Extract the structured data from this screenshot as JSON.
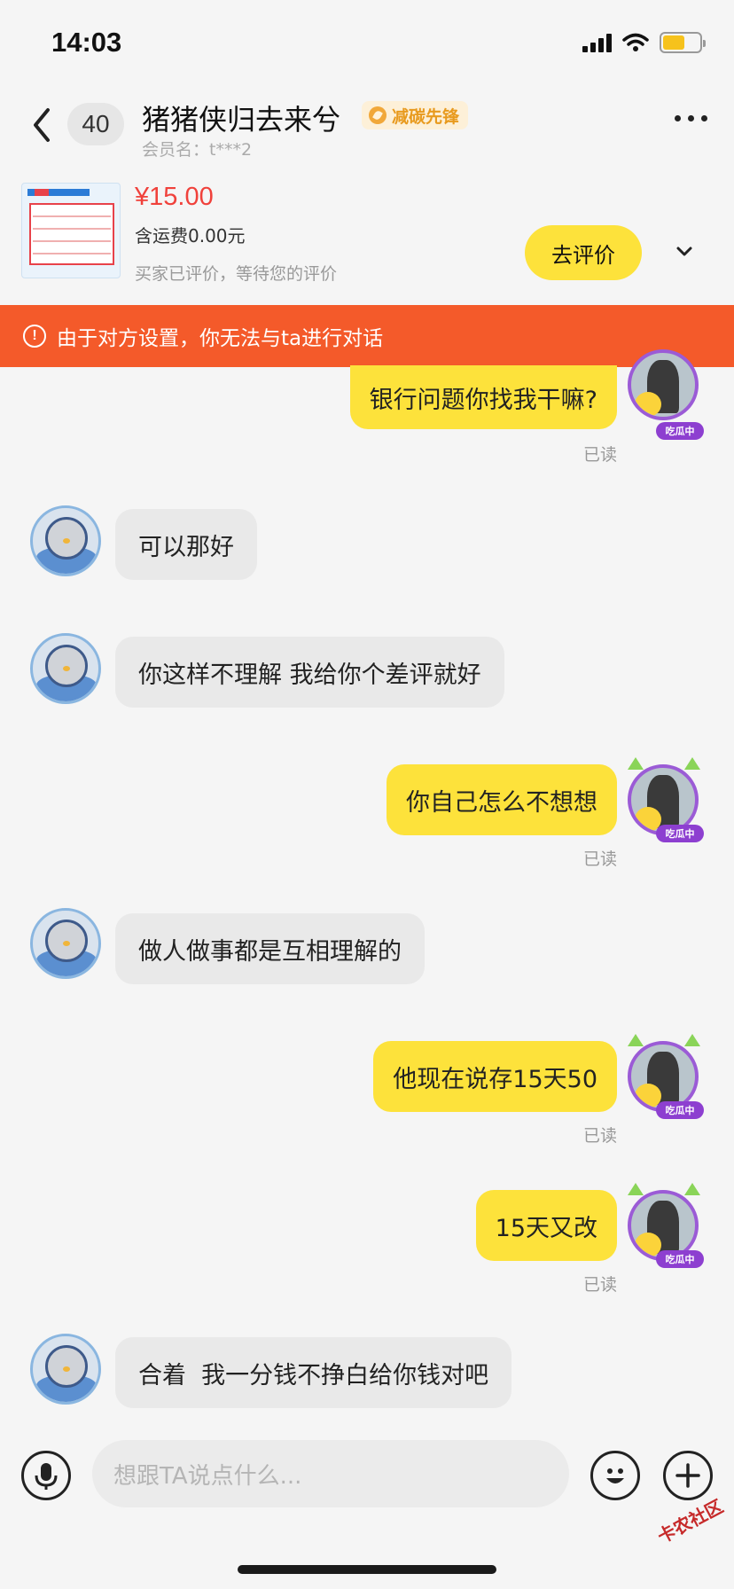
{
  "status_bar": {
    "time": "14:03"
  },
  "nav": {
    "unread_count": "40",
    "title": "猪猪侠归去来兮",
    "badge_label": "减碳先锋",
    "member_label": "会员名：t***2"
  },
  "product": {
    "price": "¥15.00",
    "shipping": "含运费0.00元",
    "review_status": "买家已评价，等待您的评价",
    "review_button": "去评价"
  },
  "warning": {
    "icon_text": "!",
    "text": "由于对方设置，你无法与ta进行对话"
  },
  "messages": [
    {
      "from": "me",
      "text": "银行问题你找我干嘛?",
      "read": "已读"
    },
    {
      "from": "other",
      "text": "可以那好"
    },
    {
      "from": "other",
      "text": "你这样不理解 我给你个差评就好"
    },
    {
      "from": "me",
      "text": "你自己怎么不想想",
      "read": "已读"
    },
    {
      "from": "other",
      "text": "做人做事都是互相理解的"
    },
    {
      "from": "me",
      "text": "他现在说存15天50",
      "read": "已读"
    },
    {
      "from": "me",
      "text": "15天又改",
      "read": "已读"
    },
    {
      "from": "other",
      "text": "合着  我一分钱不挣白给你钱对吧"
    }
  ],
  "avatar_tag": "吃瓜中",
  "input": {
    "placeholder": "想跟TA说点什么..."
  },
  "watermark": "卡农社区",
  "colors": {
    "bubble_me": "#fde23b",
    "bubble_other": "#e9e9e9",
    "warning": "#f45a2a",
    "price": "#f0413b"
  },
  "icons": [
    "back-icon",
    "more-icon",
    "chevron-down-icon",
    "warning-icon",
    "microphone-icon",
    "emoji-icon",
    "plus-icon"
  ]
}
